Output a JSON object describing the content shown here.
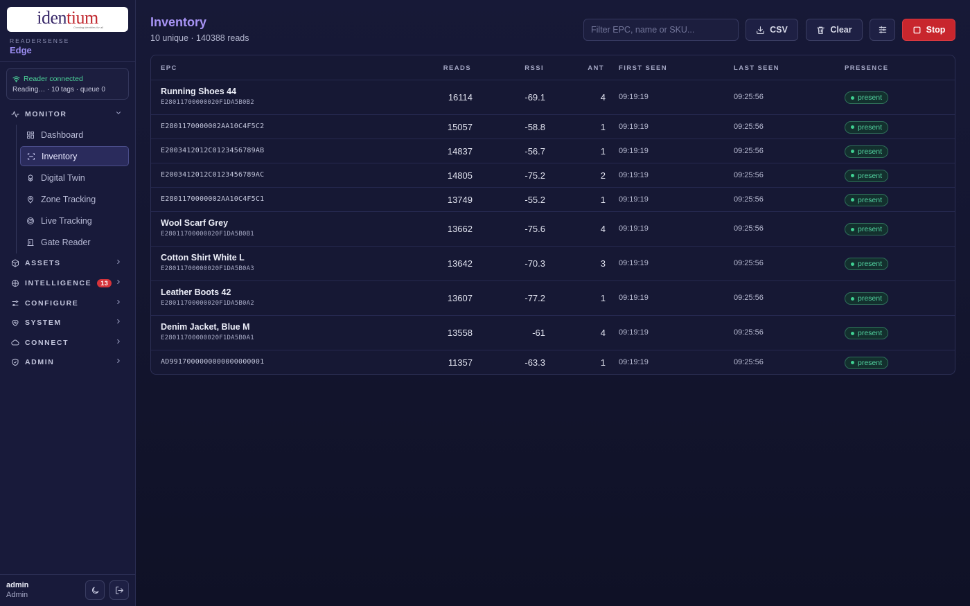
{
  "brand": {
    "logo_text_a": "iden",
    "logo_text_b": "tium",
    "logo_tagline": "Creating identities for all",
    "product": "READERSENSE",
    "edition": "Edge"
  },
  "reader_status": {
    "connection": "Reader connected",
    "detail": "Reading… · 10 tags · queue 0"
  },
  "nav": {
    "monitor": {
      "label": "MONITOR"
    },
    "monitor_items": [
      {
        "label": "Dashboard"
      },
      {
        "label": "Inventory"
      },
      {
        "label": "Digital Twin"
      },
      {
        "label": "Zone Tracking"
      },
      {
        "label": "Live Tracking"
      },
      {
        "label": "Gate Reader"
      }
    ],
    "assets": {
      "label": "ASSETS"
    },
    "intelligence": {
      "label": "INTELLIGENCE",
      "badge": "13"
    },
    "configure": {
      "label": "CONFIGURE"
    },
    "system": {
      "label": "SYSTEM"
    },
    "connect": {
      "label": "CONNECT"
    },
    "admin": {
      "label": "ADMIN"
    }
  },
  "user": {
    "name": "admin",
    "role": "Admin"
  },
  "page": {
    "title": "Inventory",
    "subtitle": "10 unique · 140388 reads"
  },
  "toolbar": {
    "filter_placeholder": "Filter EPC, name or SKU...",
    "csv_label": "CSV",
    "clear_label": "Clear",
    "stop_label": "Stop"
  },
  "table": {
    "headers": {
      "epc": "EPC",
      "reads": "READS",
      "rssi": "RSSI",
      "ant": "ANT",
      "first_seen": "FIRST SEEN",
      "last_seen": "LAST SEEN",
      "presence": "PRESENCE"
    },
    "rows": [
      {
        "name": "Running Shoes 44",
        "epc": "E28011700000020F1DA5B0B2",
        "reads": "16114",
        "rssi": "-69.1",
        "ant": "4",
        "first_seen": "09:19:19",
        "last_seen": "09:25:56",
        "presence": "present"
      },
      {
        "name": "",
        "epc": "E2801170000002AA10C4F5C2",
        "reads": "15057",
        "rssi": "-58.8",
        "ant": "1",
        "first_seen": "09:19:19",
        "last_seen": "09:25:56",
        "presence": "present"
      },
      {
        "name": "",
        "epc": "E2003412012C0123456789AB",
        "reads": "14837",
        "rssi": "-56.7",
        "ant": "1",
        "first_seen": "09:19:19",
        "last_seen": "09:25:56",
        "presence": "present"
      },
      {
        "name": "",
        "epc": "E2003412012C0123456789AC",
        "reads": "14805",
        "rssi": "-75.2",
        "ant": "2",
        "first_seen": "09:19:19",
        "last_seen": "09:25:56",
        "presence": "present"
      },
      {
        "name": "",
        "epc": "E2801170000002AA10C4F5C1",
        "reads": "13749",
        "rssi": "-55.2",
        "ant": "1",
        "first_seen": "09:19:19",
        "last_seen": "09:25:56",
        "presence": "present"
      },
      {
        "name": "Wool Scarf Grey",
        "epc": "E28011700000020F1DA5B0B1",
        "reads": "13662",
        "rssi": "-75.6",
        "ant": "4",
        "first_seen": "09:19:19",
        "last_seen": "09:25:56",
        "presence": "present"
      },
      {
        "name": "Cotton Shirt White L",
        "epc": "E28011700000020F1DA5B0A3",
        "reads": "13642",
        "rssi": "-70.3",
        "ant": "3",
        "first_seen": "09:19:19",
        "last_seen": "09:25:56",
        "presence": "present"
      },
      {
        "name": "Leather Boots 42",
        "epc": "E28011700000020F1DA5B0A2",
        "reads": "13607",
        "rssi": "-77.2",
        "ant": "1",
        "first_seen": "09:19:19",
        "last_seen": "09:25:56",
        "presence": "present"
      },
      {
        "name": "Denim Jacket, Blue M",
        "epc": "E28011700000020F1DA5B0A1",
        "reads": "13558",
        "rssi": "-61",
        "ant": "4",
        "first_seen": "09:19:19",
        "last_seen": "09:25:56",
        "presence": "present"
      },
      {
        "name": "",
        "epc": "AD9917000000000000000001",
        "reads": "11357",
        "rssi": "-63.3",
        "ant": "1",
        "first_seen": "09:19:19",
        "last_seen": "09:25:56",
        "presence": "present"
      }
    ]
  },
  "colors": {
    "accent": "#a894f5",
    "stop": "#c8262d",
    "present": "#52d3a0",
    "connected": "#4cd49a"
  }
}
